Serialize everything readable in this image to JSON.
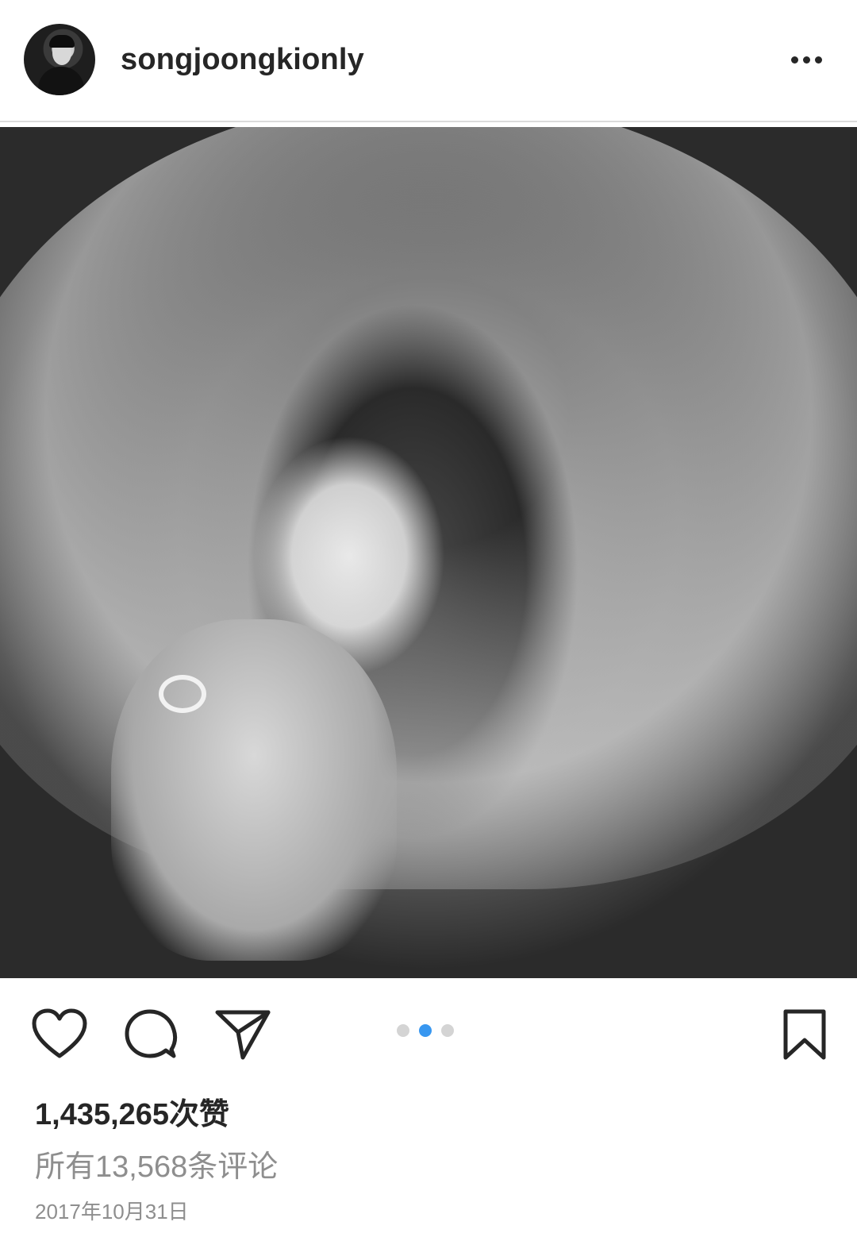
{
  "header": {
    "username": "songjoongkionly",
    "more_icon": "more-horizontal-icon"
  },
  "photo": {
    "subject": "black-and-white wedding veil portrait"
  },
  "actions": {
    "like_icon": "heart-icon",
    "comment_icon": "speech-bubble-icon",
    "share_icon": "paper-plane-icon",
    "save_icon": "bookmark-icon"
  },
  "carousel": {
    "total": 3,
    "active_index": 1,
    "active_color": "#3897f0",
    "inactive_color": "#d4d4d4"
  },
  "stats": {
    "likes": "1,435,265次赞",
    "comments": "所有13,568条评论",
    "date": "2017年10月31日"
  },
  "colors": {
    "text": "#262626",
    "muted": "#8e8e8e",
    "divider": "#dbdbdb"
  }
}
